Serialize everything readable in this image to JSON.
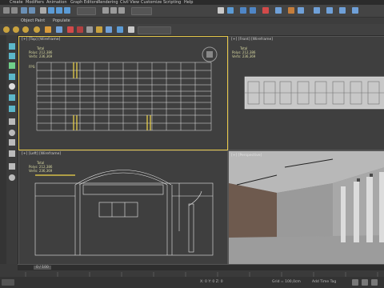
{
  "menubar": {
    "items": [
      "Create",
      "Modifiers",
      "Animation",
      "Graph Editors",
      "Rendering",
      "Civil View",
      "Customize",
      "Scripting",
      "Help"
    ]
  },
  "ribbon": {
    "tabs": [
      "Object Paint",
      "Populate"
    ]
  },
  "viewports": {
    "top": {
      "label": "[+] [Top] [Wireframe]"
    },
    "front": {
      "label": "[+] [Front] [Wireframe]"
    },
    "left": {
      "label": "[+] [Left] [Wireframe]"
    },
    "perspective": {
      "label": "[+] [Perspective]"
    }
  },
  "stats": {
    "total_label": "Total",
    "polys_label": "Polys:",
    "polys_value": "212,386",
    "verts_label": "Verts:",
    "verts_value": "236,369",
    "fps_label": "FPS:"
  },
  "timeline": {
    "frame_counter": "0 / 100"
  },
  "statusbar": {
    "coords": "X: 0  Y: 0  Z: 0",
    "grid": "Grid = 100,0cm",
    "addtime": "Add Time Tag"
  },
  "colors": {
    "active_border": "#e6c84a",
    "wireframe": "#e8e8e8",
    "highlight": "#f2d84a",
    "viewport_bg": "#3f3f3f"
  },
  "icons": [
    "undo-icon",
    "redo-icon",
    "link-icon",
    "select-icon",
    "move-icon",
    "rotate-icon",
    "scale-icon",
    "snap-icon",
    "render-icon",
    "material-icon"
  ]
}
